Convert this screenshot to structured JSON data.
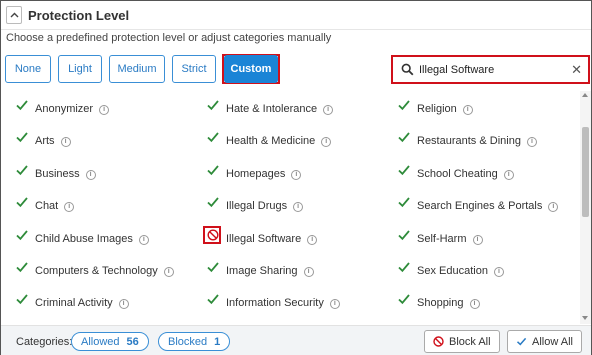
{
  "header": {
    "collapse_glyph": "^",
    "title": "Protection Level"
  },
  "subtitle": "Choose a predefined protection level or adjust categories manually",
  "levels": {
    "none": "None",
    "light": "Light",
    "medium": "Medium",
    "strict": "Strict",
    "custom": "Custom",
    "selected": "Custom"
  },
  "search": {
    "value": "Illegal Software",
    "icon": "search-icon",
    "clear_glyph": "✕"
  },
  "categories": {
    "col1": [
      {
        "label": "Anonymizer",
        "state": "allowed"
      },
      {
        "label": "Arts",
        "state": "allowed"
      },
      {
        "label": "Business",
        "state": "allowed"
      },
      {
        "label": "Chat",
        "state": "allowed"
      },
      {
        "label": "Child Abuse Images",
        "state": "allowed"
      },
      {
        "label": "Computers & Technology",
        "state": "allowed"
      },
      {
        "label": "Criminal Activity",
        "state": "allowed"
      }
    ],
    "col2": [
      {
        "label": "Hate & Intolerance",
        "state": "allowed"
      },
      {
        "label": "Health & Medicine",
        "state": "allowed"
      },
      {
        "label": "Homepages",
        "state": "allowed"
      },
      {
        "label": "Illegal Drugs",
        "state": "allowed"
      },
      {
        "label": "Illegal Software",
        "state": "blocked"
      },
      {
        "label": "Image Sharing",
        "state": "allowed"
      },
      {
        "label": "Information Security",
        "state": "allowed"
      }
    ],
    "col3": [
      {
        "label": "Religion",
        "state": "allowed"
      },
      {
        "label": "Restaurants & Dining",
        "state": "allowed"
      },
      {
        "label": "School Cheating",
        "state": "allowed"
      },
      {
        "label": "Search Engines & Portals",
        "state": "allowed"
      },
      {
        "label": "Self-Harm",
        "state": "allowed"
      },
      {
        "label": "Sex Education",
        "state": "allowed"
      },
      {
        "label": "Shopping",
        "state": "allowed"
      }
    ]
  },
  "footer": {
    "categories_label": "Categories:",
    "allowed_label": "Allowed",
    "allowed_count": "56",
    "blocked_label": "Blocked",
    "blocked_count": "1",
    "block_all": "Block All",
    "allow_all": "Allow All"
  },
  "colors": {
    "accent": "#1a84d6",
    "check": "#2e8b3a",
    "block": "#d0101a"
  }
}
